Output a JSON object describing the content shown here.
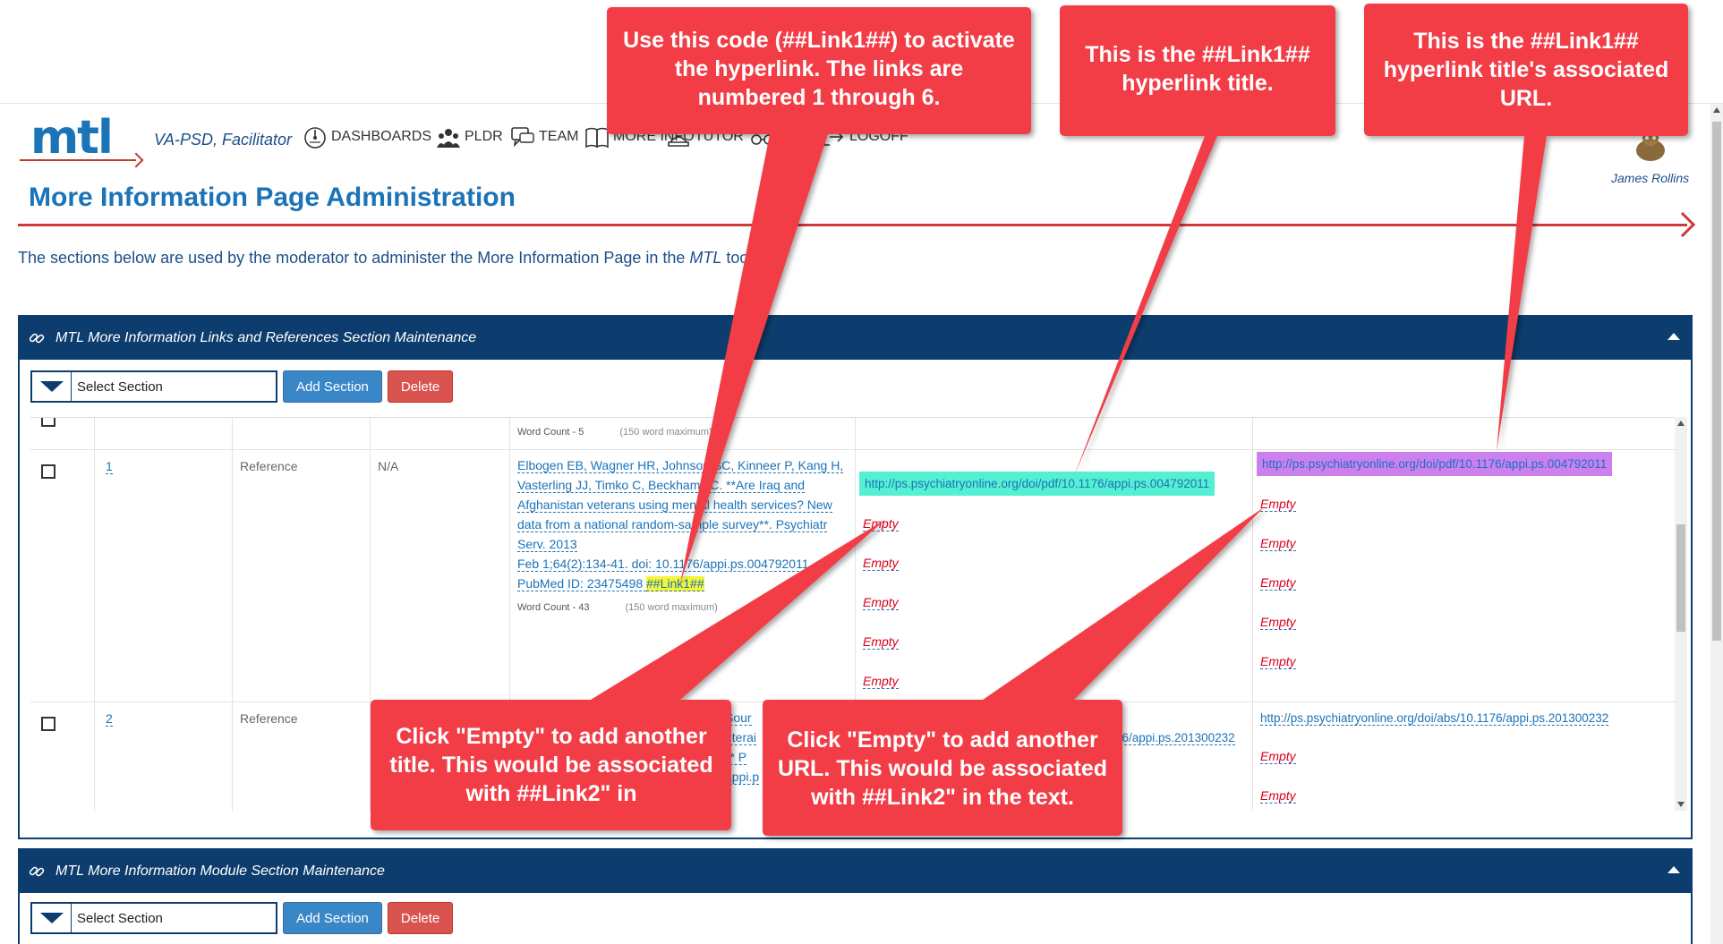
{
  "header": {
    "logo_text": "mtl",
    "role": "VA-PSD, Facilitator",
    "nav": [
      {
        "label": "DASHBOARDS",
        "icon": "dashboard-icon"
      },
      {
        "label": "PLDR",
        "icon": "group-icon"
      },
      {
        "label": "TEAM",
        "icon": "chat-icon"
      },
      {
        "label": "MORE INFO",
        "icon": "book-icon"
      },
      {
        "label": "TUTOR",
        "icon": "tutor-icon"
      },
      {
        "label": "",
        "icon": "glasses-icon"
      },
      {
        "label": "LOGOFF",
        "icon": "logoff-icon"
      }
    ],
    "user_name": "James Rollins"
  },
  "page": {
    "title": "More Information Page Administration",
    "intro_before": "The sections below are used by the moderator to administer the More Information Page in the ",
    "intro_em": "MTL",
    "intro_after": " tool."
  },
  "panel_links": {
    "title": "MTL More Information Links and References Section Maintenance",
    "select_placeholder": "Select Section",
    "add_label": "Add Section",
    "delete_label": "Delete",
    "prev_row": {
      "word_count": "Word Count -  5",
      "max": "(150 word maximum)"
    },
    "rows": [
      {
        "number": "1",
        "type": "Reference",
        "na": "N/A",
        "reference_lines": [
          " Elbogen EB, Wagner HR, Johnson SC, Kinneer P, Kang H,",
          "Vasterling JJ, Timko C, Beckham JC. **Are Iraq and",
          "Afghanistan veterans using mental health services? New",
          "data from a national random-sample survey**. Psychiatr",
          "Serv. 2013",
          "Feb 1;64(2):134-41. doi: 10.1176/appi.ps.004792011.",
          "PubMed ID: 23475498 "
        ],
        "link_code": "##Link1##",
        "word_count": "Word Count -  43",
        "max": "(150 word maximum)",
        "title_url": "http://ps.psychiatryonline.org/doi/pdf/10.1176/appi.ps.004792011",
        "url": "http://ps.psychiatryonline.org/doi/pdf/10.1176/appi.ps.004792011",
        "empty_label": "Empty"
      },
      {
        "number": "2",
        "type": "Reference",
        "reference_fragments": [
          "Sour",
          "eterai",
          "** P",
          "appi.p"
        ],
        "title_url_fragment": "76/appi.ps.201300232",
        "url": "http://ps.psychiatryonline.org/doi/abs/10.1176/appi.ps.201300232",
        "empty_label": "Empty"
      }
    ]
  },
  "panel_modules": {
    "title": "MTL More Information Module Section Maintenance",
    "select_placeholder": "Select Section",
    "add_label": "Add Section",
    "delete_label": "Delete"
  },
  "callouts": {
    "code": "Use this code (##Link1##) to activate the hyperlink.  The links are numbered 1 through 6.",
    "title": "This is the ##Link1## hyperlink title.",
    "url": "This is the ##Link1## hyperlink title's associated URL.",
    "empty_title": "Click \"Empty\" to add another title. This would be associated with ##Link2\" in",
    "empty_url": "Click \"Empty\" to add another URL. This would be associated with ##Link2\" in the text."
  },
  "colors": {
    "brand_blue": "#1b73b8",
    "panel_navy": "#0d3d6e",
    "callout_red": "#f23d46",
    "link_highlight_yellow": "#f5f53b",
    "title_highlight_cyan": "#55f0d2",
    "url_highlight_violet": "#cc80f0",
    "empty_red": "#d9001b"
  }
}
